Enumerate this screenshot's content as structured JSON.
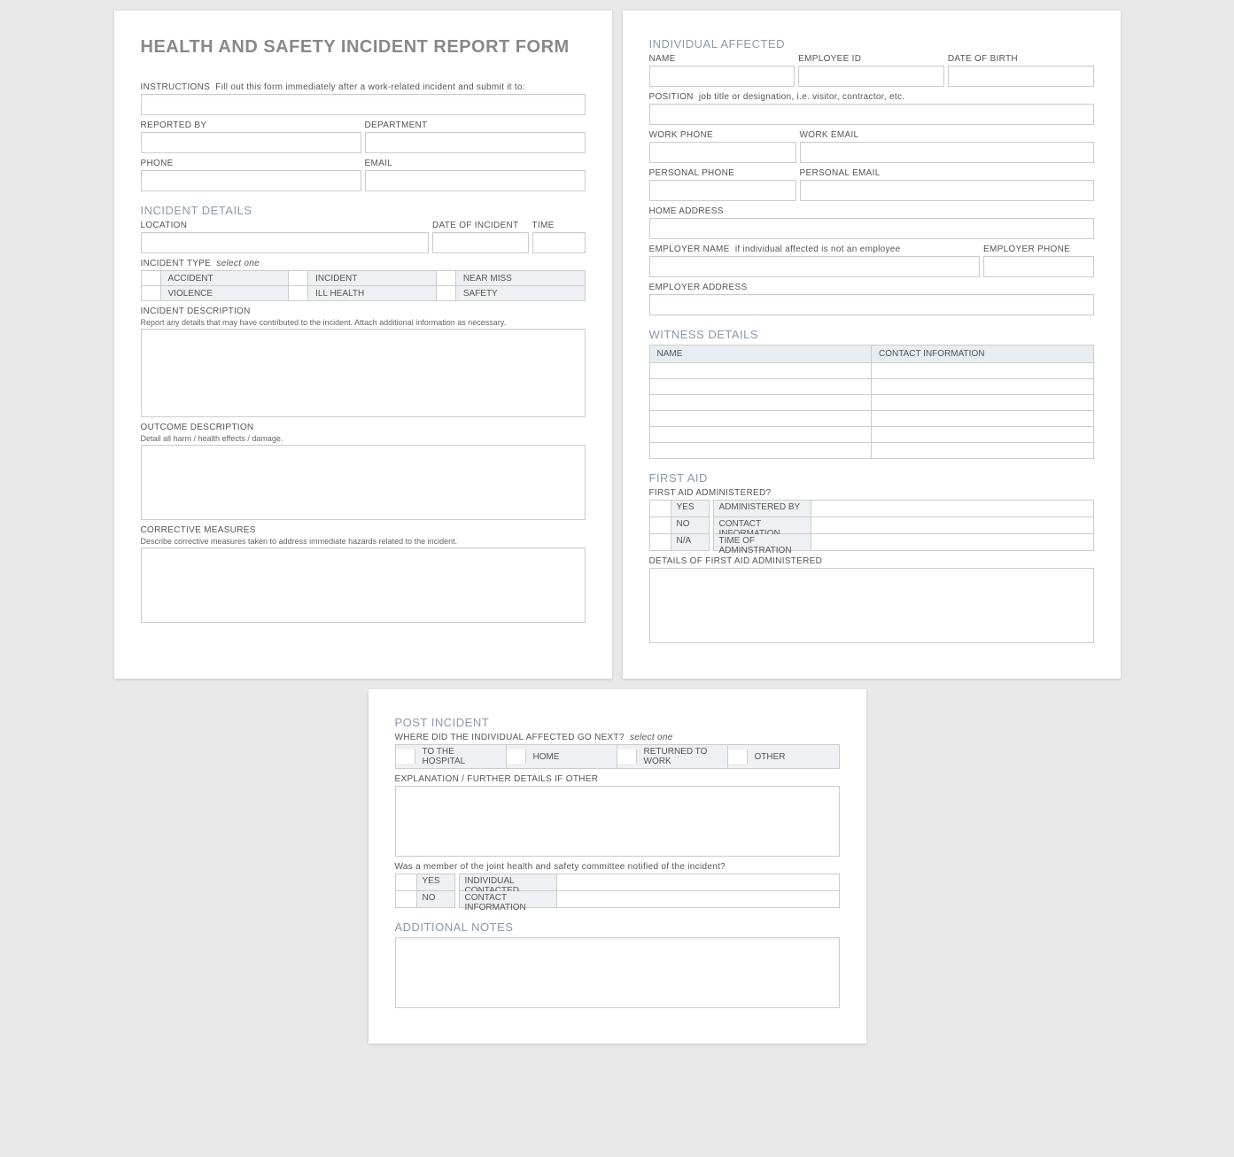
{
  "title": "HEALTH AND SAFETY INCIDENT REPORT FORM",
  "instructions": {
    "label": "INSTRUCTIONS",
    "text": "Fill out this form immediately after a work-related incident and submit it to:"
  },
  "reporter": {
    "reported_by": "REPORTED BY",
    "department": "DEPARTMENT",
    "phone": "PHONE",
    "email": "EMAIL"
  },
  "incident_details": {
    "heading": "INCIDENT DETAILS",
    "location": "LOCATION",
    "date": "DATE OF INCIDENT",
    "time": "TIME",
    "type_label": "INCIDENT TYPE",
    "type_hint": "select one",
    "types": [
      "ACCIDENT",
      "INCIDENT",
      "NEAR MISS",
      "VIOLENCE",
      "ILL HEALTH",
      "SAFETY"
    ],
    "desc_label": "INCIDENT DESCRIPTION",
    "desc_hint": "Report any details that may have contributed to the incident.  Attach additional information as necessary.",
    "outcome_label": "OUTCOME DESCRIPTION",
    "outcome_hint": "Detail all harm / health effects / damage.",
    "corrective_label": "CORRECTIVE MEASURES",
    "corrective_hint": "Describe corrective measures taken to address immediate hazards related to the incident."
  },
  "individual": {
    "heading": "INDIVIDUAL AFFECTED",
    "name": "NAME",
    "emp_id": "EMPLOYEE ID",
    "dob": "DATE OF BIRTH",
    "position_label": "POSITION",
    "position_hint": "job title or designation, i.e. visitor, contractor, etc.",
    "work_phone": "WORK PHONE",
    "work_email": "WORK EMAIL",
    "personal_phone": "PERSONAL PHONE",
    "personal_email": "PERSONAL EMAIL",
    "home_address": "HOME ADDRESS",
    "employer_name_label": "EMPLOYER NAME",
    "employer_name_hint": "if individual affected is not an employee",
    "employer_phone": "EMPLOYER PHONE",
    "employer_address": "EMPLOYER ADDRESS"
  },
  "witness": {
    "heading": "WITNESS DETAILS",
    "cols": [
      "NAME",
      "CONTACT INFORMATION"
    ],
    "row_count": 6
  },
  "first_aid": {
    "heading": "FIRST AID",
    "admin_q": "FIRST AID ADMINISTERED?",
    "opts": [
      "YES",
      "NO",
      "N/A"
    ],
    "fields": [
      "ADMINISTERED BY",
      "CONTACT INFORMATION",
      "TIME OF ADMINSTRATION"
    ],
    "details_label": "DETAILS OF FIRST AID ADMINISTERED"
  },
  "post_incident": {
    "heading": "POST INCIDENT",
    "where_label": "WHERE DID THE INDIVIDUAL AFFECTED GO NEXT?",
    "where_hint": "select one",
    "where_opts": [
      "TO THE HOSPITAL",
      "HOME",
      "RETURNED TO WORK",
      "OTHER"
    ],
    "explain_label": "EXPLANATION / FURTHER DETAILS IF OTHER",
    "committee_q": "Was a member of the joint health and safety committee notified of the incident?",
    "committee_opts": [
      "YES",
      "NO"
    ],
    "committee_fields": [
      "INDIVIDUAL CONTACTED",
      "CONTACT INFORMATION"
    ]
  },
  "notes": {
    "heading": "ADDITIONAL NOTES"
  }
}
